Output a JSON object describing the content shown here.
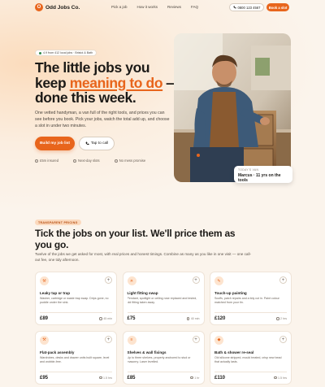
{
  "nav": {
    "brand": "Odd Jobs Co.",
    "brand_initial": "O",
    "links": [
      "Pick a job",
      "How it works",
      "Reviews",
      "FAQ"
    ],
    "phone": "0800 123 4567",
    "book_label": "Book a slot"
  },
  "hero": {
    "badge": "4.9 from 412 local jobs · Bristol & Bath",
    "headline_1": "The little jobs you keep ",
    "headline_accent": "meaning to do",
    "headline_2": " — done this week.",
    "lede": "One vetted handyman, a van full of the right tools, and prices you can see before you book. Pick your jobs, watch the total add up, and choose a slot in under two minutes.",
    "primary_cta": "Build my job list",
    "secondary_cta": "Tap to call",
    "trust": [
      "£5m insured",
      "Next-day slots",
      "No mess promise"
    ],
    "caption_kicker": "TODAY'S VAN",
    "caption_value": "Marcus · 11 yrs on the tools"
  },
  "pricing": {
    "tag": "TRANSPARENT PRICING",
    "title": "Tick the jobs on your list. We'll price them as you go.",
    "subtitle": "Twelve of the jobs we get asked for most, with real prices and honest timings. Combine as many as you like in one visit — one call-out fee, one tidy afternoon.",
    "cards": [
      {
        "icon": "wrench-icon",
        "glyph": "⚒",
        "title": "Leaky tap or trap",
        "desc": "Washer, cartridge or waste trap swap. Drips gone, no puddle under the sink.",
        "price": "£89",
        "duration": "45 min"
      },
      {
        "icon": "bulb-icon",
        "glyph": "☀",
        "title": "Light fitting swap",
        "desc": "Pendant, spotlight or ceiling rose replaced and tested, old fitting taken away.",
        "price": "£75",
        "duration": "40 min"
      },
      {
        "icon": "brush-icon",
        "glyph": "✎",
        "title": "Touch-up painting",
        "desc": "Scuffs, patch repairs and a tidy cut in. Paint colour matched from your tin.",
        "price": "£120",
        "duration": "2 hrs"
      },
      {
        "icon": "hammer-icon",
        "glyph": "⚒",
        "title": "Flat-pack assembly",
        "desc": "Wardrobes, desks and drawer units built square, level and wobble-free.",
        "price": "£95",
        "duration": "1.5 hrs"
      },
      {
        "icon": "shelf-icon",
        "glyph": "≡",
        "title": "Shelves & wall fixings",
        "desc": "Up to three shelves, properly anchored to stud or masonry. Laser levelled.",
        "price": "£85",
        "duration": "1 hr"
      },
      {
        "icon": "drop-icon",
        "glyph": "◆",
        "title": "Bath & shower re-seal",
        "desc": "Old silicone stripped, mould treated, crisp new bead that actually lasts.",
        "price": "£110",
        "duration": "1.5 hrs"
      }
    ]
  },
  "colors": {
    "accent": "#e8651c",
    "background": "#fbf4ec"
  }
}
